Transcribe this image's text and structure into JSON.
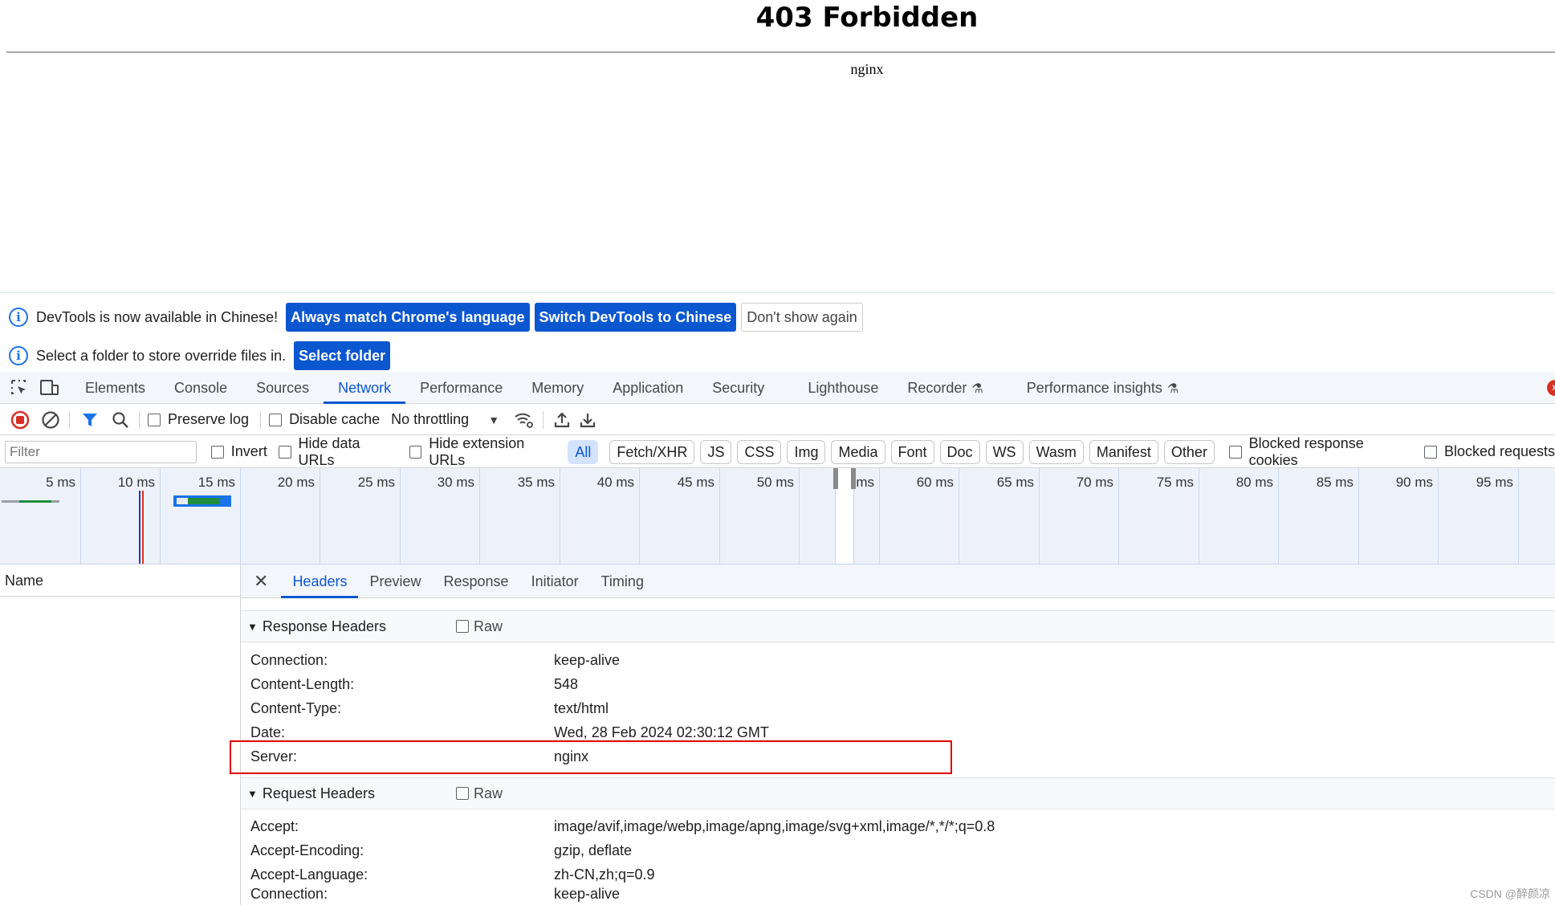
{
  "page": {
    "title": "403 Forbidden",
    "server": "nginx"
  },
  "infobars": {
    "language": {
      "text": "DevTools is now available in Chinese!",
      "btn_match": "Always match Chrome's language",
      "btn_switch": "Switch DevTools to Chinese",
      "btn_dismiss": "Don't show again"
    },
    "overrides": {
      "text": "Select a folder to store override files in.",
      "btn_select": "Select folder"
    }
  },
  "main_tabs": [
    "Elements",
    "Console",
    "Sources",
    "Network",
    "Performance",
    "Memory",
    "Application",
    "Security",
    "Lighthouse",
    "Recorder",
    "Performance insights"
  ],
  "active_main_tab": "Network",
  "toolbar": {
    "preserve_log": "Preserve log",
    "disable_cache": "Disable cache",
    "throttling": "No throttling"
  },
  "filter": {
    "placeholder": "Filter",
    "invert": "Invert",
    "hide_data_urls": "Hide data URLs",
    "hide_extension_urls": "Hide extension URLs",
    "types": [
      "All",
      "Fetch/XHR",
      "JS",
      "CSS",
      "Img",
      "Media",
      "Font",
      "Doc",
      "WS",
      "Wasm",
      "Manifest",
      "Other"
    ],
    "active_type": "All",
    "blocked_cookies": "Blocked response cookies",
    "blocked_requests": "Blocked requests"
  },
  "timeline": {
    "ticks": [
      "5 ms",
      "10 ms",
      "15 ms",
      "20 ms",
      "25 ms",
      "30 ms",
      "35 ms",
      "40 ms",
      "45 ms",
      "50 ms",
      "55 ms",
      "60 ms",
      "65 ms",
      "70 ms",
      "75 ms",
      "80 ms",
      "85 ms",
      "90 ms",
      "95 ms"
    ]
  },
  "name_column": {
    "header": "Name"
  },
  "detail_tabs": [
    "Headers",
    "Preview",
    "Response",
    "Initiator",
    "Timing"
  ],
  "active_detail_tab": "Headers",
  "response_headers": {
    "title": "Response Headers",
    "raw_label": "Raw",
    "rows": [
      {
        "k": "Connection:",
        "v": "keep-alive"
      },
      {
        "k": "Content-Length:",
        "v": "548"
      },
      {
        "k": "Content-Type:",
        "v": "text/html"
      },
      {
        "k": "Date:",
        "v": "Wed, 28 Feb 2024 02:30:12 GMT"
      },
      {
        "k": "Server:",
        "v": "nginx"
      }
    ]
  },
  "request_headers": {
    "title": "Request Headers",
    "raw_label": "Raw",
    "rows": [
      {
        "k": "Accept:",
        "v": "image/avif,image/webp,image/apng,image/svg+xml,image/*,*/*;q=0.8"
      },
      {
        "k": "Accept-Encoding:",
        "v": "gzip, deflate"
      },
      {
        "k": "Accept-Language:",
        "v": "zh-CN,zh;q=0.9"
      },
      {
        "k": "Connection:",
        "v": "keep-alive"
      }
    ]
  },
  "watermark": "CSDN @醉颜凉"
}
